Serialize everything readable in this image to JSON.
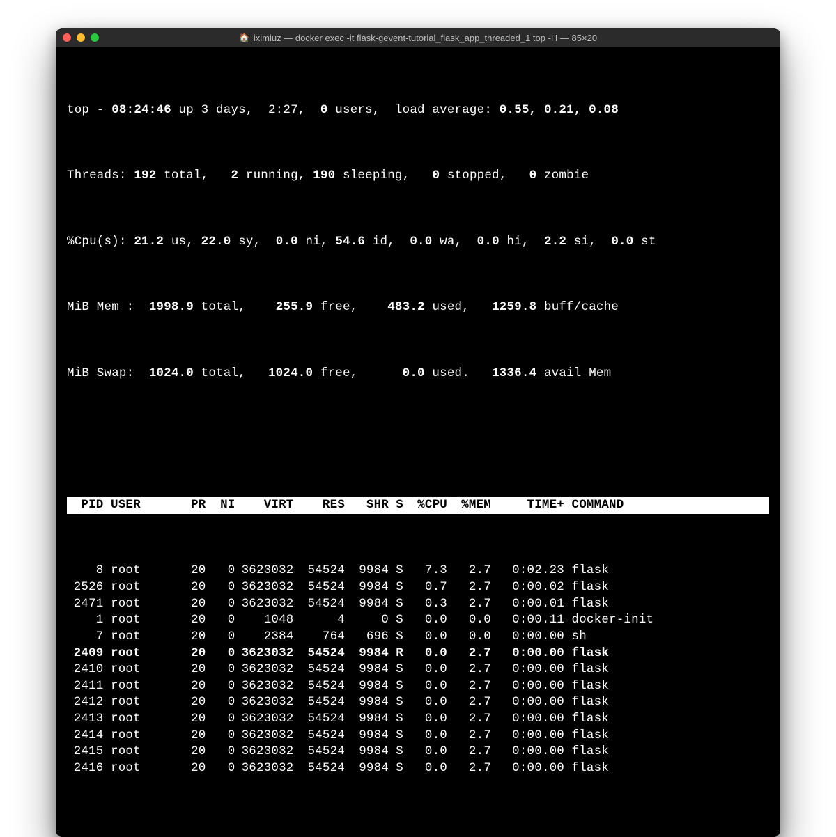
{
  "window": {
    "title": "iximiuz — docker exec -it flask-gevent-tutorial_flask_app_threaded_1 top -H — 85×20"
  },
  "summary": {
    "line1_pre": "top - ",
    "time": "08:24:46",
    "line1_mid": " up 3 days,  2:27,  ",
    "users": "0",
    "line1_users_suffix": " users,  load average: ",
    "loadavg": "0.55, 0.21, 0.08",
    "threads_label": "Threads: ",
    "threads_total": "192",
    "threads_total_suffix": " total,   ",
    "threads_running": "2",
    "threads_running_suffix": " running, ",
    "threads_sleeping": "190",
    "threads_sleeping_suffix": " sleeping,   ",
    "threads_stopped": "0",
    "threads_stopped_suffix": " stopped,   ",
    "threads_zombie": "0",
    "threads_zombie_suffix": " zombie",
    "cpu_label": "%Cpu(s): ",
    "cpu_us": "21.2",
    "cpu_us_suffix": " us, ",
    "cpu_sy": "22.0",
    "cpu_sy_suffix": " sy,  ",
    "cpu_ni": "0.0",
    "cpu_ni_suffix": " ni, ",
    "cpu_id": "54.6",
    "cpu_id_suffix": " id,  ",
    "cpu_wa": "0.0",
    "cpu_wa_suffix": " wa,  ",
    "cpu_hi": "0.0",
    "cpu_hi_suffix": " hi,  ",
    "cpu_si": "2.2",
    "cpu_si_suffix": " si,  ",
    "cpu_st": "0.0",
    "cpu_st_suffix": " st",
    "mem_label": "MiB Mem :  ",
    "mem_total": "1998.9",
    "mem_total_suffix": " total,    ",
    "mem_free": "255.9",
    "mem_free_suffix": " free,    ",
    "mem_used": "483.2",
    "mem_used_suffix": " used,   ",
    "mem_buff": "1259.8",
    "mem_buff_suffix": " buff/cache",
    "swap_label": "MiB Swap:  ",
    "swap_total": "1024.0",
    "swap_total_suffix": " total,   ",
    "swap_free": "1024.0",
    "swap_free_suffix": " free,      ",
    "swap_used": "0.0",
    "swap_used_suffix": " used.   ",
    "swap_avail": "1336.4",
    "swap_avail_suffix": " avail Mem"
  },
  "columns": {
    "pid": "PID",
    "user": "USER",
    "pr": "PR",
    "ni": "NI",
    "virt": "VIRT",
    "res": "RES",
    "shr": "SHR",
    "s": "S",
    "cpu": "%CPU",
    "mem": "%MEM",
    "time": "TIME+",
    "cmd": "COMMAND"
  },
  "rows": [
    {
      "pid": "8",
      "user": "root",
      "pr": "20",
      "ni": "0",
      "virt": "3623032",
      "res": "54524",
      "shr": "9984",
      "s": "S",
      "cpu": "7.3",
      "mem": "2.7",
      "time": "0:02.23",
      "cmd": "flask",
      "bold": false
    },
    {
      "pid": "2526",
      "user": "root",
      "pr": "20",
      "ni": "0",
      "virt": "3623032",
      "res": "54524",
      "shr": "9984",
      "s": "S",
      "cpu": "0.7",
      "mem": "2.7",
      "time": "0:00.02",
      "cmd": "flask",
      "bold": false
    },
    {
      "pid": "2471",
      "user": "root",
      "pr": "20",
      "ni": "0",
      "virt": "3623032",
      "res": "54524",
      "shr": "9984",
      "s": "S",
      "cpu": "0.3",
      "mem": "2.7",
      "time": "0:00.01",
      "cmd": "flask",
      "bold": false
    },
    {
      "pid": "1",
      "user": "root",
      "pr": "20",
      "ni": "0",
      "virt": "1048",
      "res": "4",
      "shr": "0",
      "s": "S",
      "cpu": "0.0",
      "mem": "0.0",
      "time": "0:00.11",
      "cmd": "docker-init",
      "bold": false
    },
    {
      "pid": "7",
      "user": "root",
      "pr": "20",
      "ni": "0",
      "virt": "2384",
      "res": "764",
      "shr": "696",
      "s": "S",
      "cpu": "0.0",
      "mem": "0.0",
      "time": "0:00.00",
      "cmd": "sh",
      "bold": false
    },
    {
      "pid": "2409",
      "user": "root",
      "pr": "20",
      "ni": "0",
      "virt": "3623032",
      "res": "54524",
      "shr": "9984",
      "s": "R",
      "cpu": "0.0",
      "mem": "2.7",
      "time": "0:00.00",
      "cmd": "flask",
      "bold": true
    },
    {
      "pid": "2410",
      "user": "root",
      "pr": "20",
      "ni": "0",
      "virt": "3623032",
      "res": "54524",
      "shr": "9984",
      "s": "S",
      "cpu": "0.0",
      "mem": "2.7",
      "time": "0:00.00",
      "cmd": "flask",
      "bold": false
    },
    {
      "pid": "2411",
      "user": "root",
      "pr": "20",
      "ni": "0",
      "virt": "3623032",
      "res": "54524",
      "shr": "9984",
      "s": "S",
      "cpu": "0.0",
      "mem": "2.7",
      "time": "0:00.00",
      "cmd": "flask",
      "bold": false
    },
    {
      "pid": "2412",
      "user": "root",
      "pr": "20",
      "ni": "0",
      "virt": "3623032",
      "res": "54524",
      "shr": "9984",
      "s": "S",
      "cpu": "0.0",
      "mem": "2.7",
      "time": "0:00.00",
      "cmd": "flask",
      "bold": false
    },
    {
      "pid": "2413",
      "user": "root",
      "pr": "20",
      "ni": "0",
      "virt": "3623032",
      "res": "54524",
      "shr": "9984",
      "s": "S",
      "cpu": "0.0",
      "mem": "2.7",
      "time": "0:00.00",
      "cmd": "flask",
      "bold": false
    },
    {
      "pid": "2414",
      "user": "root",
      "pr": "20",
      "ni": "0",
      "virt": "3623032",
      "res": "54524",
      "shr": "9984",
      "s": "S",
      "cpu": "0.0",
      "mem": "2.7",
      "time": "0:00.00",
      "cmd": "flask",
      "bold": false
    },
    {
      "pid": "2415",
      "user": "root",
      "pr": "20",
      "ni": "0",
      "virt": "3623032",
      "res": "54524",
      "shr": "9984",
      "s": "S",
      "cpu": "0.0",
      "mem": "2.7",
      "time": "0:00.00",
      "cmd": "flask",
      "bold": false
    },
    {
      "pid": "2416",
      "user": "root",
      "pr": "20",
      "ni": "0",
      "virt": "3623032",
      "res": "54524",
      "shr": "9984",
      "s": "S",
      "cpu": "0.0",
      "mem": "2.7",
      "time": "0:00.00",
      "cmd": "flask",
      "bold": false
    }
  ]
}
